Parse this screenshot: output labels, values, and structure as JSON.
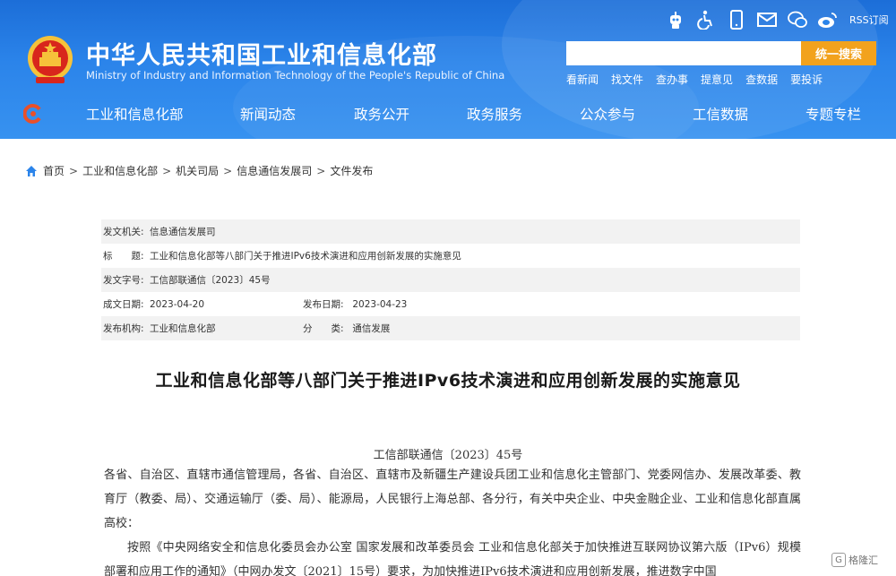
{
  "header": {
    "title": "中华人民共和国工业和信息化部",
    "subtitle": "Ministry of Industry and Information Technology of the People's Republic of China",
    "rss_label": "RSS订阅",
    "top_icons": [
      "robot-icon",
      "accessibility-icon",
      "mobile-icon",
      "mail-icon",
      "wechat-icon",
      "weibo-icon"
    ],
    "search": {
      "placeholder": "",
      "button_label": "统一搜索"
    },
    "quick_links": [
      "看新闻",
      "找文件",
      "查办事",
      "提意见",
      "查数据",
      "要投诉"
    ],
    "nav": [
      "工业和信息化部",
      "新闻动态",
      "政务公开",
      "政务服务",
      "公众参与",
      "工信数据",
      "专题专栏"
    ],
    "brand_color": "#2b84ea",
    "accent_color": "#f2a21d"
  },
  "breadcrumb": [
    "首页",
    "工业和信息化部",
    "机关司局",
    "信息通信发展司",
    "文件发布"
  ],
  "info": {
    "issuer_label": "发文机关:",
    "issuer": "信息通信发展司",
    "title_label": "标　　题:",
    "title": "工业和信息化部等八部门关于推进IPv6技术演进和应用创新发展的实施意见",
    "doc_no_label": "发文字号:",
    "doc_no": "工信部联通信〔2023〕45号",
    "created_label": "成文日期:",
    "created": "2023-04-20",
    "published_label": "发布日期:",
    "published": "2023-04-23",
    "publisher_label": "发布机构:",
    "publisher": "工业和信息化部",
    "category_label": "分　　类:",
    "category": "通信发展"
  },
  "document": {
    "title": "工业和信息化部等八部门关于推进IPv6技术演进和应用创新发展的实施意见",
    "number": "工信部联通信〔2023〕45号",
    "addressees": "各省、自治区、直辖市通信管理局，各省、自治区、直辖市及新疆生产建设兵团工业和信息化主管部门、党委网信办、发展改革委、教育厅（教委、局）、交通运输厅（委、局）、能源局，人民银行上海总部、各分行，有关中央企业、中央金融企业、工业和信息化部直属高校：",
    "paragraph1": "按照《中央网络安全和信息化委员会办公室 国家发展和改革委员会 工业和信息化部关于加快推进互联网协议第六版（IPv6）规模部署和应用工作的通知》（中网办发文〔2021〕15号）要求，为加快推进IPv6技术演进和应用创新发展，推进数字中国"
  },
  "watermark": "格隆汇"
}
